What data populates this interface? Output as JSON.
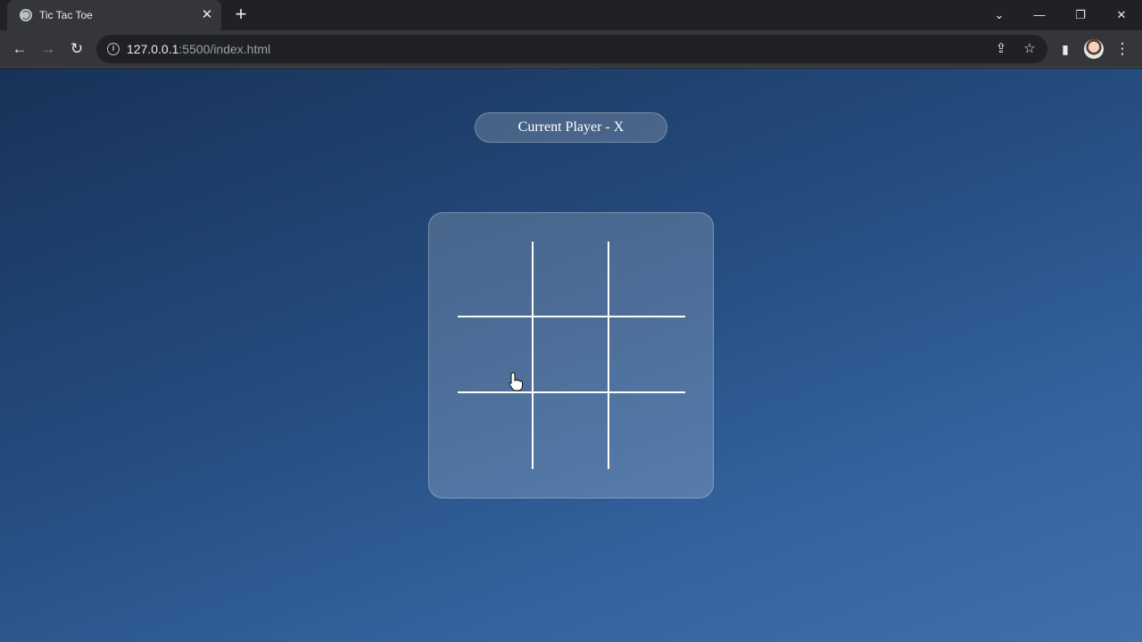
{
  "browser": {
    "tab_title": "Tic Tac Toe",
    "tab_close": "✕",
    "new_tab": "+",
    "url_host": "127.0.0.1",
    "url_rest": ":5500/index.html",
    "window_controls": {
      "dropdown": "⌄",
      "minimize": "—",
      "restore": "❐",
      "close": "✕"
    },
    "nav": {
      "back": "←",
      "forward": "→",
      "reload": "↻"
    },
    "icons": {
      "info": "i",
      "share": "⇪",
      "bookmark": "☆",
      "side_panel": "▮",
      "menu": "⋮"
    }
  },
  "game": {
    "status": "Current Player - X",
    "board": [
      "",
      "",
      "",
      "",
      "",
      "",
      "",
      "",
      ""
    ]
  },
  "colors": {
    "page_gradient_start": "#183258",
    "page_gradient_end": "#416fad",
    "grid_lines": "#ffffff"
  }
}
